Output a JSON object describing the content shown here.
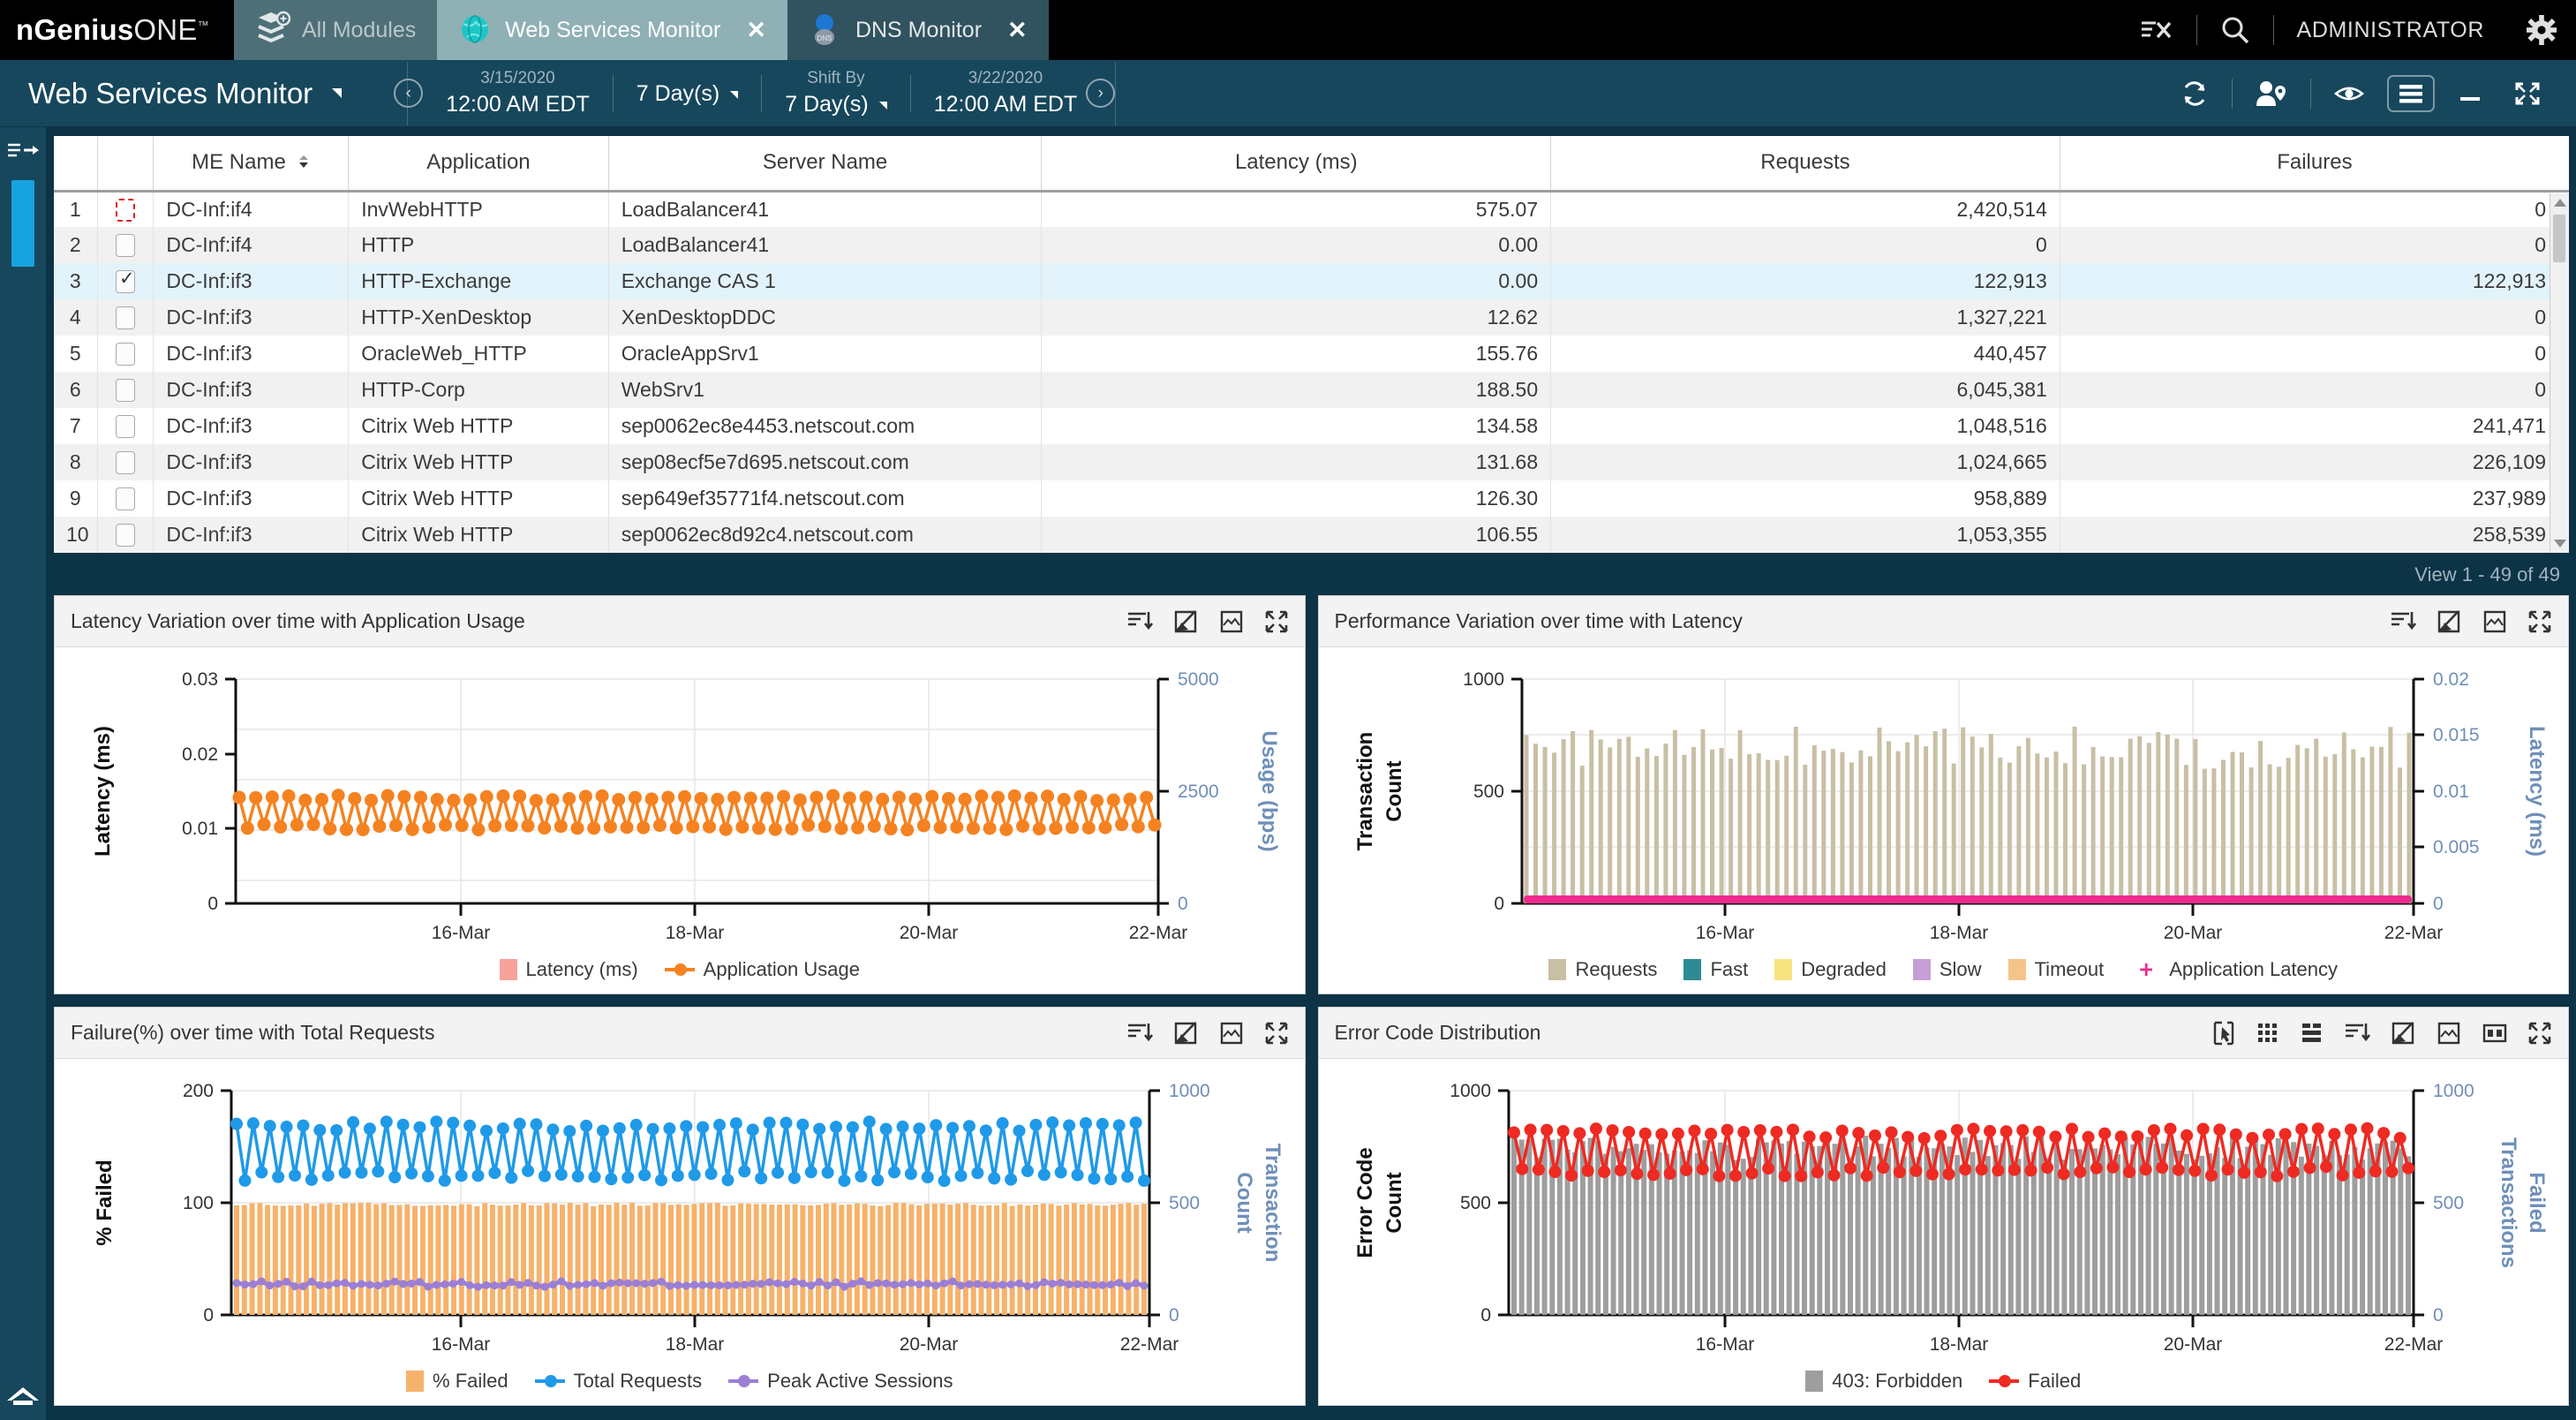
{
  "app": {
    "brand_bold": "nGenius",
    "brand_light": "ONE",
    "brand_tm": "™"
  },
  "tabs": [
    {
      "label": "All Modules",
      "icon": "modules-icon",
      "active": false,
      "closable": false
    },
    {
      "label": "Web Services Monitor",
      "icon": "globe-icon",
      "active": true,
      "closable": true,
      "close_label": "✕"
    },
    {
      "label": "DNS Monitor",
      "icon": "dns-icon",
      "active": false,
      "closable": true,
      "close_label": "✕"
    }
  ],
  "topbar": {
    "clear_icon": "clear-filter-icon",
    "search_icon": "search-icon",
    "user_label": "ADMINISTRATOR",
    "settings_icon": "gear-icon"
  },
  "subbar": {
    "title": "Web Services Monitor",
    "prev_label": "‹",
    "next_label": "›",
    "start": {
      "date": "3/15/2020",
      "time": "12:00 AM EDT"
    },
    "duration": {
      "label": "",
      "value": "7 Day(s)"
    },
    "shift": {
      "label": "Shift By",
      "value": "7 Day(s)"
    },
    "end": {
      "date": "3/22/2020",
      "time": "12:00 AM EDT"
    },
    "actions": [
      {
        "name": "refresh-icon"
      },
      {
        "name": "user-location-icon"
      },
      {
        "name": "eye-icon"
      },
      {
        "name": "menu-icon"
      },
      {
        "name": "minimize-icon"
      },
      {
        "name": "expand-icon"
      }
    ]
  },
  "rail": {
    "toggle_icon": "panel-expand-icon",
    "home_icon": "home-icon"
  },
  "table": {
    "columns": [
      "",
      "",
      "ME Name",
      "Application",
      "Server Name",
      "Latency (ms)",
      "Requests",
      "Failures"
    ],
    "sort_column": "ME Name",
    "sort_dir": "desc",
    "rows": [
      {
        "n": "1",
        "me": "DC-Inf:if4",
        "app": "InvWebHTTP",
        "server": "LoadBalancer41",
        "latency": "575.07",
        "requests": "2,420,514",
        "failures": "0",
        "checked": false,
        "focused": true,
        "selected": false
      },
      {
        "n": "2",
        "me": "DC-Inf:if4",
        "app": "HTTP",
        "server": "LoadBalancer41",
        "latency": "0.00",
        "requests": "0",
        "failures": "0",
        "checked": false,
        "focused": false,
        "selected": false
      },
      {
        "n": "3",
        "me": "DC-Inf:if3",
        "app": "HTTP-Exchange",
        "server": "Exchange CAS 1",
        "latency": "0.00",
        "requests": "122,913",
        "failures": "122,913",
        "checked": true,
        "focused": false,
        "selected": true
      },
      {
        "n": "4",
        "me": "DC-Inf:if3",
        "app": "HTTP-XenDesktop",
        "server": "XenDesktopDDC",
        "latency": "12.62",
        "requests": "1,327,221",
        "failures": "0",
        "checked": false,
        "focused": false,
        "selected": false
      },
      {
        "n": "5",
        "me": "DC-Inf:if3",
        "app": "OracleWeb_HTTP",
        "server": "OracleAppSrv1",
        "latency": "155.76",
        "requests": "440,457",
        "failures": "0",
        "checked": false,
        "focused": false,
        "selected": false
      },
      {
        "n": "6",
        "me": "DC-Inf:if3",
        "app": "HTTP-Corp",
        "server": "WebSrv1",
        "latency": "188.50",
        "requests": "6,045,381",
        "failures": "0",
        "checked": false,
        "focused": false,
        "selected": false
      },
      {
        "n": "7",
        "me": "DC-Inf:if3",
        "app": "Citrix Web HTTP",
        "server": "sep0062ec8e4453.netscout.com",
        "latency": "134.58",
        "requests": "1,048,516",
        "failures": "241,471",
        "checked": false,
        "focused": false,
        "selected": false
      },
      {
        "n": "8",
        "me": "DC-Inf:if3",
        "app": "Citrix Web HTTP",
        "server": "sep08ecf5e7d695.netscout.com",
        "latency": "131.68",
        "requests": "1,024,665",
        "failures": "226,109",
        "checked": false,
        "focused": false,
        "selected": false
      },
      {
        "n": "9",
        "me": "DC-Inf:if3",
        "app": "Citrix Web HTTP",
        "server": "sep649ef35771f4.netscout.com",
        "latency": "126.30",
        "requests": "958,889",
        "failures": "237,989",
        "checked": false,
        "focused": false,
        "selected": false
      },
      {
        "n": "10",
        "me": "DC-Inf:if3",
        "app": "Citrix Web HTTP",
        "server": "sep0062ec8d92c4.netscout.com",
        "latency": "106.55",
        "requests": "1,053,355",
        "failures": "258,539",
        "checked": false,
        "focused": false,
        "selected": false
      }
    ],
    "view_count": "View 1 - 49 of 49"
  },
  "panels": [
    {
      "id": "latency-variation",
      "title": "Latency Variation over time with Application Usage",
      "icons": [
        "sort-icon",
        "pencil-chart-icon",
        "image-icon",
        "fullscreen-icon"
      ],
      "legend": [
        {
          "label": "Latency (ms)",
          "color": "#f7a399",
          "type": "swatch"
        },
        {
          "label": "Application Usage",
          "color": "#f58220",
          "type": "line"
        }
      ]
    },
    {
      "id": "performance-variation",
      "title": "Performance Variation over time with Latency",
      "icons": [
        "sort-icon",
        "pencil-chart-icon",
        "image-icon",
        "fullscreen-icon"
      ],
      "legend": [
        {
          "label": "Requests",
          "color": "#c9bfa4",
          "type": "swatch"
        },
        {
          "label": "Fast",
          "color": "#2e8b95",
          "type": "swatch"
        },
        {
          "label": "Degraded",
          "color": "#f7e37f",
          "type": "swatch"
        },
        {
          "label": "Slow",
          "color": "#c79fd6",
          "type": "swatch"
        },
        {
          "label": "Timeout",
          "color": "#f5c489",
          "type": "swatch"
        },
        {
          "label": "Application Latency",
          "color": "#ee2a8c",
          "type": "cross"
        }
      ]
    },
    {
      "id": "failure-percent",
      "title": "Failure(%) over time with Total Requests",
      "icons": [
        "sort-icon",
        "pencil-chart-icon",
        "image-icon",
        "fullscreen-icon"
      ],
      "legend": [
        {
          "label": "% Failed",
          "color": "#f6b26b",
          "type": "swatch"
        },
        {
          "label": "Total Requests",
          "color": "#1f9ae8",
          "type": "line"
        },
        {
          "label": "Peak Active Sessions",
          "color": "#9b7fd4",
          "type": "line"
        }
      ]
    },
    {
      "id": "error-code-distribution",
      "title": "Error Code Distribution",
      "icons": [
        "select-tool-icon",
        "grid-icon",
        "list-icon",
        "sort-icon",
        "pencil-chart-icon",
        "image-icon",
        "compare-icon",
        "fullscreen-icon"
      ],
      "legend": [
        {
          "label": "403: Forbidden",
          "color": "#9e9e9e",
          "type": "swatch"
        },
        {
          "label": "Failed",
          "color": "#ee2a22",
          "type": "line"
        }
      ]
    }
  ],
  "chart_data": [
    {
      "id": "latency-variation",
      "type": "line",
      "title": "Latency Variation over time with Application Usage",
      "ylabel": "Latency (ms)",
      "y2label": "Usage (bps)",
      "yticks": [
        0,
        0.01,
        0.02,
        0.03
      ],
      "y2ticks": [
        0,
        2500,
        5000
      ],
      "ylim": [
        0,
        0.03
      ],
      "y2lim": [
        0,
        5000
      ],
      "xticks": [
        "16-Mar",
        "18-Mar",
        "20-Mar",
        "22-Mar"
      ],
      "xlim": [
        "15-Mar 00:00",
        "22-Mar 00:00"
      ],
      "grid": true,
      "series": [
        {
          "name": "Latency (ms)",
          "color": "#f7a399",
          "axis": "left",
          "values": []
        },
        {
          "name": "Application Usage",
          "color": "#f58220",
          "axis": "right",
          "note": "oscillating zig-zag between ~1700 and ~2350 bps, ~56 cycles over 7 days",
          "min": 1700,
          "max": 2350,
          "mean": 2020
        }
      ]
    },
    {
      "id": "performance-variation",
      "type": "bar",
      "title": "Performance Variation over time with Latency",
      "ylabel": "Transaction Count",
      "y2label": "Latency (ms)",
      "yticks": [
        0,
        500,
        1000
      ],
      "y2ticks": [
        0,
        0.005,
        0.01,
        0.015,
        0.02
      ],
      "ylim": [
        0,
        1000
      ],
      "y2lim": [
        0,
        0.02
      ],
      "xticks": [
        "16-Mar",
        "18-Mar",
        "20-Mar",
        "22-Mar"
      ],
      "grid": true,
      "series": [
        {
          "name": "Requests",
          "color": "#c9bfa4",
          "axis": "left",
          "note": "thin vertical bars varying ~600-790 transactions",
          "min": 600,
          "max": 790
        },
        {
          "name": "Fast",
          "color": "#2e8b95",
          "axis": "left",
          "values": []
        },
        {
          "name": "Degraded",
          "color": "#f7e37f",
          "axis": "left",
          "values": []
        },
        {
          "name": "Slow",
          "color": "#c79fd6",
          "axis": "left",
          "values": []
        },
        {
          "name": "Timeout",
          "color": "#f5c489",
          "axis": "left",
          "values": []
        },
        {
          "name": "Application Latency",
          "color": "#ee2a8c",
          "axis": "right",
          "note": "flat near 0 across full range",
          "min": 0,
          "max": 0.0005
        }
      ]
    },
    {
      "id": "failure-percent",
      "type": "bar",
      "title": "Failure(%) over time with Total Requests",
      "ylabel": "% Failed",
      "y2label": "Transaction Count",
      "yticks": [
        0,
        100,
        200
      ],
      "y2ticks": [
        0,
        500,
        1000
      ],
      "ylim": [
        0,
        200
      ],
      "y2lim": [
        0,
        1000
      ],
      "xticks": [
        "16-Mar",
        "18-Mar",
        "20-Mar",
        "22-Mar"
      ],
      "grid": true,
      "series": [
        {
          "name": "% Failed",
          "color": "#f6b26b",
          "axis": "left",
          "note": "dense bars all near 98-100%",
          "min": 97,
          "max": 100
        },
        {
          "name": "Total Requests",
          "color": "#1f9ae8",
          "axis": "right",
          "note": "zig-zag band between ~620 and ~840 transactions",
          "min": 620,
          "max": 840
        },
        {
          "name": "Peak Active Sessions",
          "color": "#9b7fd4",
          "axis": "right",
          "note": "nearly flat band around ~135 transactions",
          "min": 125,
          "max": 150
        }
      ]
    },
    {
      "id": "error-code-distribution",
      "type": "bar",
      "title": "Error Code Distribution",
      "ylabel": "Error Code Count",
      "y2label": "Failed Transactions",
      "yticks": [
        0,
        500,
        1000
      ],
      "y2ticks": [
        0,
        500,
        1000
      ],
      "ylim": [
        0,
        1000
      ],
      "y2lim": [
        0,
        1000
      ],
      "xticks": [
        "16-Mar",
        "18-Mar",
        "20-Mar",
        "22-Mar"
      ],
      "grid": true,
      "series": [
        {
          "name": "403: Forbidden",
          "color": "#9e9e9e",
          "axis": "left",
          "note": "dense grey bars around 700-790",
          "min": 690,
          "max": 800
        },
        {
          "name": "Failed",
          "color": "#ee2a22",
          "axis": "right",
          "note": "zig-zag band between ~640 and ~810 failed transactions",
          "min": 640,
          "max": 810
        }
      ]
    }
  ]
}
